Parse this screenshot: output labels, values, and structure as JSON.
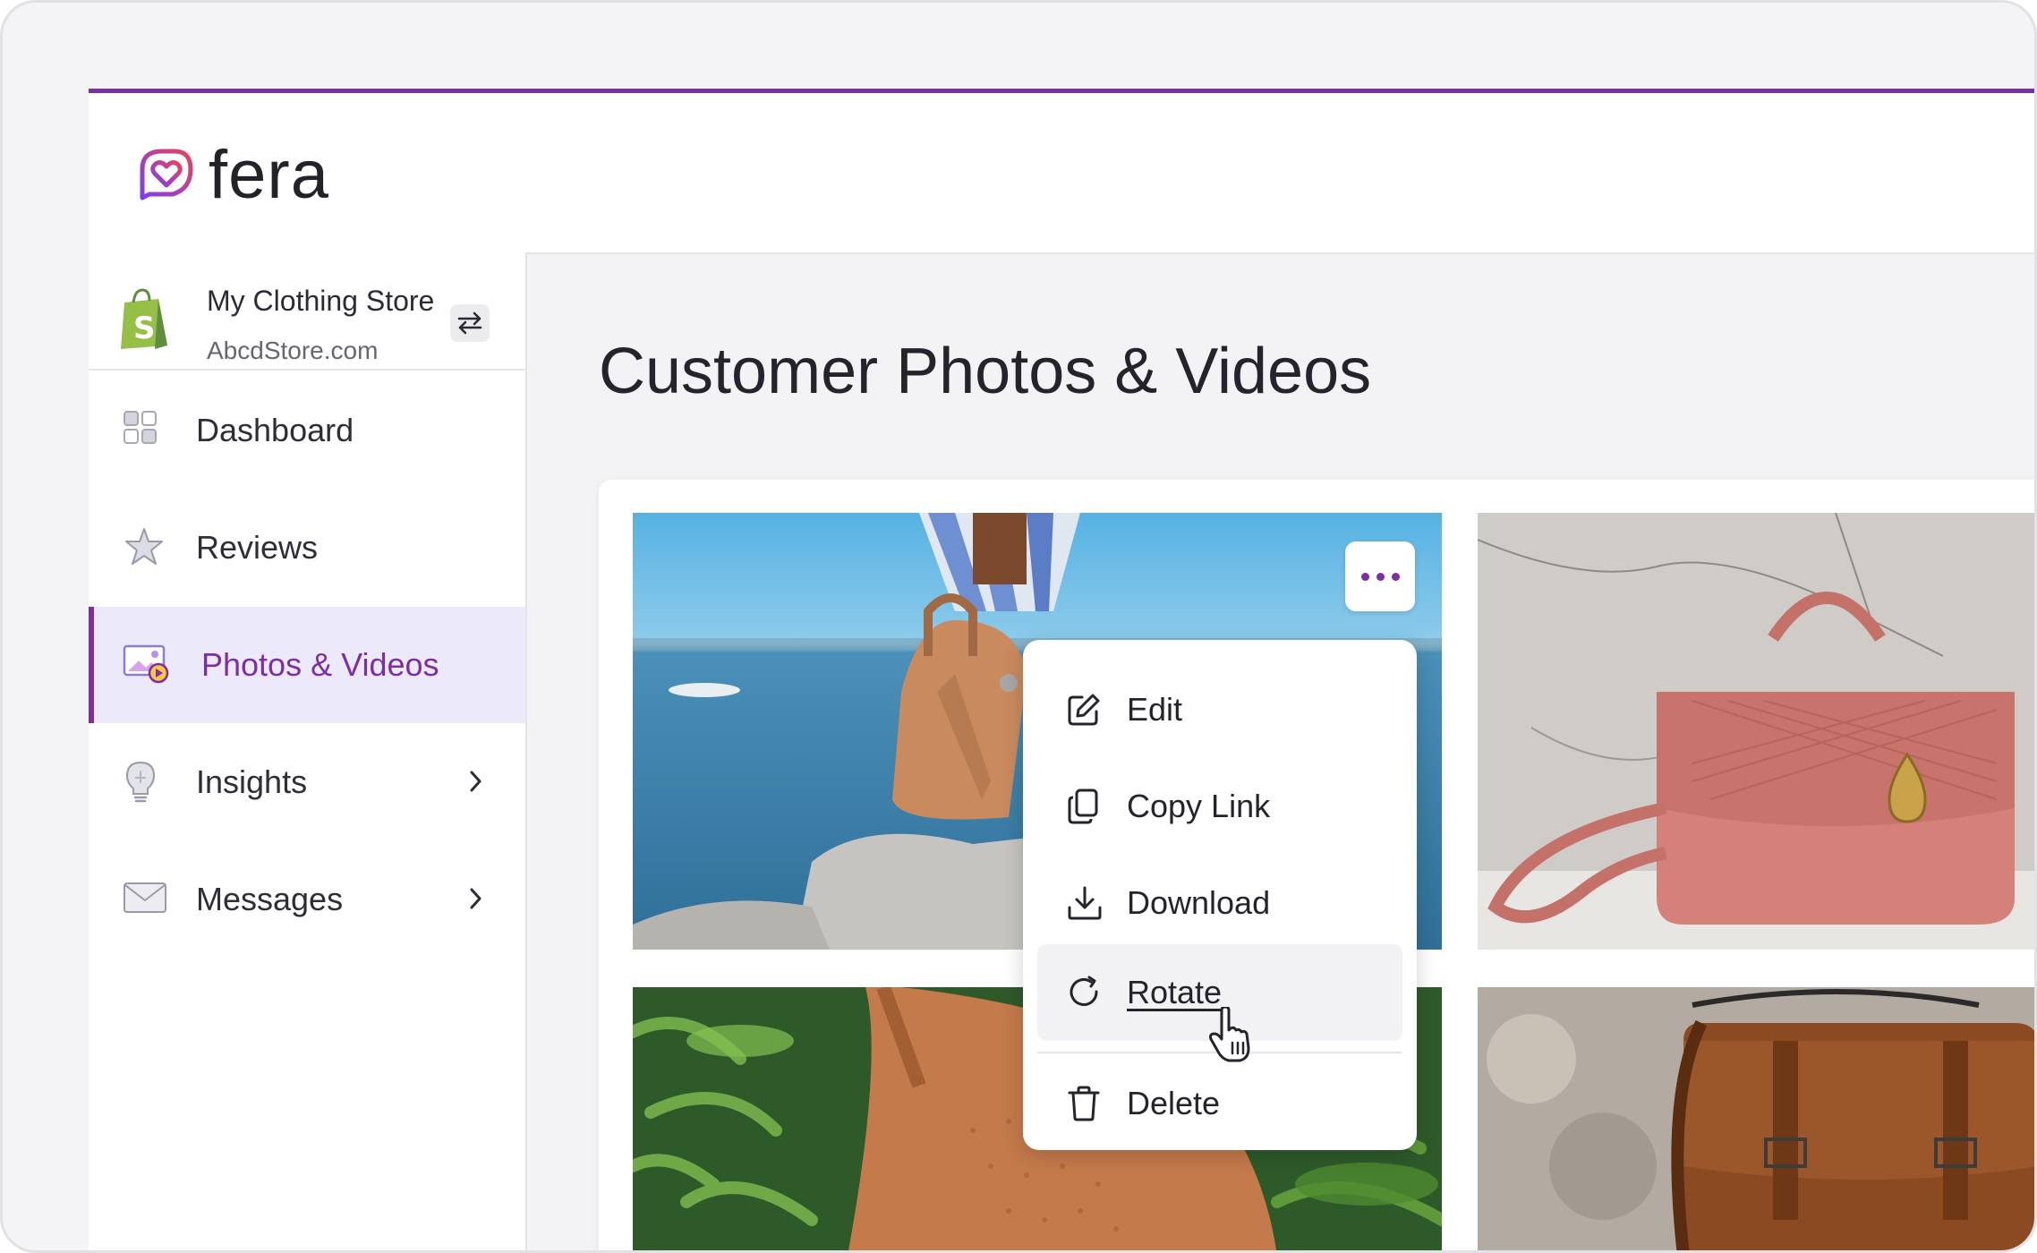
{
  "brand": {
    "name": "fera",
    "accent": "#7b2fa2",
    "logo_gradient": [
      "#7b3ff2",
      "#e8435a"
    ]
  },
  "store": {
    "name": "My Clothing Store",
    "url": "AbcdStore.com",
    "platform_icon": "shopify-bag-icon",
    "switch_icon": "swap-arrows-icon"
  },
  "sidebar": {
    "items": [
      {
        "label": "Dashboard",
        "icon": "dashboard-grid-icon",
        "active": false,
        "has_chevron": false
      },
      {
        "label": "Reviews",
        "icon": "star-icon",
        "active": false,
        "has_chevron": false
      },
      {
        "label": "Photos & Videos",
        "icon": "photo-video-icon",
        "active": true,
        "has_chevron": false
      },
      {
        "label": "Insights",
        "icon": "lightbulb-icon",
        "active": false,
        "has_chevron": true
      },
      {
        "label": "Messages",
        "icon": "envelope-icon",
        "active": false,
        "has_chevron": true
      }
    ]
  },
  "main": {
    "title": "Customer Photos & Videos",
    "photos": [
      {
        "subject": "tan handbag by the sea"
      },
      {
        "subject": "pink quilted handbag on marble"
      },
      {
        "subject": "perforated tan bag among plants"
      },
      {
        "subject": "brown leather satchel"
      }
    ],
    "more_button_icon": "more-horizontal-icon"
  },
  "context_menu": {
    "items": [
      {
        "label": "Edit",
        "icon": "edit-icon"
      },
      {
        "label": "Copy Link",
        "icon": "copy-icon"
      },
      {
        "label": "Download",
        "icon": "download-icon"
      },
      {
        "label": "Rotate",
        "icon": "rotate-icon",
        "hovered": true
      },
      {
        "label": "Delete",
        "icon": "trash-icon"
      }
    ]
  }
}
